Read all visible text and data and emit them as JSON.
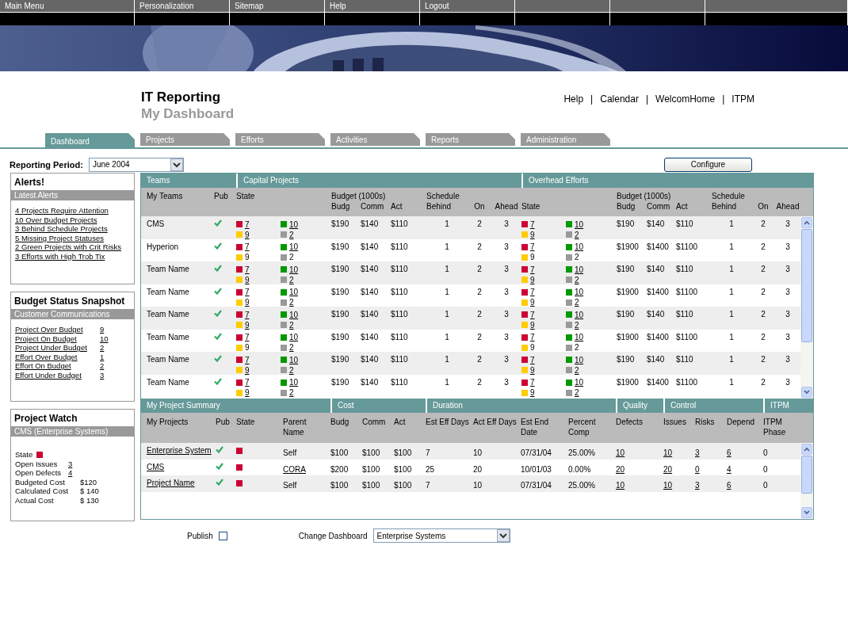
{
  "menu": [
    {
      "label": "Main Menu"
    },
    {
      "label": "Personalization"
    },
    {
      "label": "Sitemap"
    },
    {
      "label": "Help"
    },
    {
      "label": "Logout"
    }
  ],
  "header": {
    "title": "IT Reporting",
    "subtitle": "My Dashboard",
    "separator": "|",
    "links": [
      "Help",
      "Calendar",
      "WelcomHome",
      "ITPM"
    ]
  },
  "tabs": [
    {
      "label": "Dashboard",
      "selected": true
    },
    {
      "label": "Projects",
      "selected": false
    },
    {
      "label": "Efforts",
      "selected": false
    },
    {
      "label": "Activities",
      "selected": false
    },
    {
      "label": "Reports",
      "selected": false
    },
    {
      "label": "Administration",
      "selected": false
    }
  ],
  "reporting_period": {
    "label": "Reporting Period:",
    "value": "June 2004"
  },
  "configure_button": "Configure",
  "sidebar": [
    {
      "title": "Alerts!",
      "subtitle": "Latest Alerts",
      "items": [
        {
          "kind": "link",
          "label": "4 Projects Require Attention"
        },
        {
          "kind": "link",
          "label": "10 Over Budget Projects"
        },
        {
          "kind": "link",
          "label": "3 Behind Schedule Projects"
        },
        {
          "kind": "link",
          "label": "5 Missing Project Statuses"
        },
        {
          "kind": "link",
          "label": "2 Green Projects with Crit Risks"
        },
        {
          "kind": "link",
          "label": "3 Efforts with High Trob Tix"
        }
      ]
    },
    {
      "title": "Budget Status Snapshot",
      "subtitle": "Customer Communications",
      "items": [
        {
          "kind": "count",
          "label": "Project Over Budget",
          "value": "9"
        },
        {
          "kind": "count",
          "label": "Project On Budget",
          "value": "10"
        },
        {
          "kind": "count",
          "label": "Project Under Budget",
          "value": "2"
        },
        {
          "kind": "count",
          "label": "Effort Over Budget",
          "value": "1"
        },
        {
          "kind": "count",
          "label": "Effort On Budget",
          "value": "2"
        },
        {
          "kind": "count",
          "label": "Effort Under Budget",
          "value": "3"
        }
      ]
    },
    {
      "title": "Project Watch",
      "subtitle": "CMS (Enterprise Systems)",
      "items": [
        {
          "kind": "status",
          "label": "State",
          "color": "#cc0033"
        },
        {
          "kind": "count",
          "label": "Open Issues",
          "value": "3"
        },
        {
          "kind": "count",
          "label": "Open Defects",
          "value": "4"
        },
        {
          "kind": "text",
          "label": "Budgeted Cost",
          "value": "$120"
        },
        {
          "kind": "text",
          "label": "Calculated Cost",
          "value": "$ 140"
        },
        {
          "kind": "text",
          "label": "Actual Cost",
          "value": "$ 130"
        }
      ]
    }
  ],
  "teams_table": {
    "groups": [
      "Teams",
      "Capital Projects",
      "Overhead Efforts"
    ],
    "team_columns": {
      "name": "My Teams",
      "pub": "Pub"
    },
    "capital_columns": {
      "state": "State",
      "budget": "Budget (1000s)",
      "budg": "Budg",
      "comm": "Comm",
      "act": "Act",
      "schedule": "Schedule",
      "behind": "Behind",
      "on": "On",
      "ahead": "Ahead"
    },
    "overhead_columns": {
      "state": "State",
      "budget": "Budget (1000s)",
      "budg": "Budg",
      "comm": "Comm",
      "act": "Act",
      "schedule": "Schedule",
      "behind": "Behind",
      "on": "On",
      "ahead": "Ahead"
    },
    "rows": [
      {
        "name": "CMS",
        "pub": true,
        "capital": {
          "states": [
            {
              "color": "#cc0033",
              "count": "7",
              "linked": true
            },
            {
              "color": "#ffcc00",
              "count": "9",
              "linked": true
            },
            {
              "color": "#009900",
              "count": "10",
              "linked": true
            },
            {
              "color": "#999999",
              "count": "2",
              "linked": true
            }
          ],
          "budg": "$190",
          "comm": "$140",
          "act": "$110",
          "behind": "1",
          "on": "2",
          "ahead": "3"
        },
        "overhead": {
          "states": [
            {
              "color": "#cc0033",
              "count": "7",
              "linked": true
            },
            {
              "color": "#ffcc00",
              "count": "9",
              "linked": true
            },
            {
              "color": "#009900",
              "count": "10",
              "linked": true
            },
            {
              "color": "#999999",
              "count": "2",
              "linked": true
            }
          ],
          "budg": "$190",
          "comm": "$140",
          "act": "$110",
          "behind": "1",
          "on": "2",
          "ahead": "3"
        }
      },
      {
        "name": "Hyperion",
        "pub": true,
        "capital": {
          "states": [
            {
              "color": "#cc0033",
              "count": "7",
              "linked": true
            },
            {
              "color": "#ffcc00",
              "count": "9",
              "linked": false
            },
            {
              "color": "#009900",
              "count": "10",
              "linked": true
            },
            {
              "color": "#999999",
              "count": "2",
              "linked": false
            }
          ],
          "budg": "$190",
          "comm": "$140",
          "act": "$110",
          "behind": "1",
          "on": "2",
          "ahead": "3"
        },
        "overhead": {
          "states": [
            {
              "color": "#cc0033",
              "count": "7",
              "linked": true
            },
            {
              "color": "#ffcc00",
              "count": "9",
              "linked": false
            },
            {
              "color": "#009900",
              "count": "10",
              "linked": true
            },
            {
              "color": "#999999",
              "count": "2",
              "linked": false
            }
          ],
          "budg": "$1900",
          "comm": "$1400",
          "act": "$1100",
          "behind": "1",
          "on": "2",
          "ahead": "3"
        }
      },
      {
        "name": "Team Name",
        "pub": true,
        "capital": {
          "states": [
            {
              "color": "#cc0033",
              "count": "7",
              "linked": true
            },
            {
              "color": "#ffcc00",
              "count": "9",
              "linked": true
            },
            {
              "color": "#009900",
              "count": "10",
              "linked": true
            },
            {
              "color": "#999999",
              "count": "2",
              "linked": true
            }
          ],
          "budg": "$190",
          "comm": "$140",
          "act": "$110",
          "behind": "1",
          "on": "2",
          "ahead": "3"
        },
        "overhead": {
          "states": [
            {
              "color": "#cc0033",
              "count": "7",
              "linked": true
            },
            {
              "color": "#ffcc00",
              "count": "9",
              "linked": true
            },
            {
              "color": "#009900",
              "count": "10",
              "linked": true
            },
            {
              "color": "#999999",
              "count": "2",
              "linked": true
            }
          ],
          "budg": "$190",
          "comm": "$140",
          "act": "$110",
          "behind": "1",
          "on": "2",
          "ahead": "3"
        }
      },
      {
        "name": "Team Name",
        "pub": true,
        "capital": {
          "states": [
            {
              "color": "#cc0033",
              "count": "7",
              "linked": true
            },
            {
              "color": "#ffcc00",
              "count": "9",
              "linked": true
            },
            {
              "color": "#009900",
              "count": "10",
              "linked": true
            },
            {
              "color": "#999999",
              "count": "2",
              "linked": true
            }
          ],
          "budg": "$190",
          "comm": "$140",
          "act": "$110",
          "behind": "1",
          "on": "2",
          "ahead": "3"
        },
        "overhead": {
          "states": [
            {
              "color": "#cc0033",
              "count": "7",
              "linked": true
            },
            {
              "color": "#ffcc00",
              "count": "9",
              "linked": true
            },
            {
              "color": "#009900",
              "count": "10",
              "linked": true
            },
            {
              "color": "#999999",
              "count": "2",
              "linked": true
            }
          ],
          "budg": "$1900",
          "comm": "$1400",
          "act": "$1100",
          "behind": "1",
          "on": "2",
          "ahead": "3"
        }
      },
      {
        "name": "Team Name",
        "pub": true,
        "capital": {
          "states": [
            {
              "color": "#cc0033",
              "count": "7",
              "linked": true
            },
            {
              "color": "#ffcc00",
              "count": "9",
              "linked": true
            },
            {
              "color": "#009900",
              "count": "10",
              "linked": true
            },
            {
              "color": "#999999",
              "count": "2",
              "linked": true
            }
          ],
          "budg": "$190",
          "comm": "$140",
          "act": "$110",
          "behind": "1",
          "on": "2",
          "ahead": "3"
        },
        "overhead": {
          "states": [
            {
              "color": "#cc0033",
              "count": "7",
              "linked": true
            },
            {
              "color": "#ffcc00",
              "count": "9",
              "linked": true
            },
            {
              "color": "#009900",
              "count": "10",
              "linked": true
            },
            {
              "color": "#999999",
              "count": "2",
              "linked": true
            }
          ],
          "budg": "$190",
          "comm": "$140",
          "act": "$110",
          "behind": "1",
          "on": "2",
          "ahead": "3"
        }
      },
      {
        "name": "Team Name",
        "pub": true,
        "capital": {
          "states": [
            {
              "color": "#cc0033",
              "count": "7",
              "linked": true
            },
            {
              "color": "#ffcc00",
              "count": "9",
              "linked": false
            },
            {
              "color": "#009900",
              "count": "10",
              "linked": true
            },
            {
              "color": "#999999",
              "count": "2",
              "linked": true
            }
          ],
          "budg": "$190",
          "comm": "$140",
          "act": "$110",
          "behind": "1",
          "on": "2",
          "ahead": "3"
        },
        "overhead": {
          "states": [
            {
              "color": "#cc0033",
              "count": "7",
              "linked": true
            },
            {
              "color": "#ffcc00",
              "count": "9",
              "linked": false
            },
            {
              "color": "#009900",
              "count": "10",
              "linked": true
            },
            {
              "color": "#999999",
              "count": "2",
              "linked": false
            }
          ],
          "budg": "$1900",
          "comm": "$1400",
          "act": "$1100",
          "behind": "1",
          "on": "2",
          "ahead": "3"
        }
      },
      {
        "name": "Team Name",
        "pub": true,
        "capital": {
          "states": [
            {
              "color": "#cc0033",
              "count": "7",
              "linked": true
            },
            {
              "color": "#ffcc00",
              "count": "9",
              "linked": true
            },
            {
              "color": "#009900",
              "count": "10",
              "linked": true
            },
            {
              "color": "#999999",
              "count": "2",
              "linked": true
            }
          ],
          "budg": "$190",
          "comm": "$140",
          "act": "$110",
          "behind": "1",
          "on": "2",
          "ahead": "3"
        },
        "overhead": {
          "states": [
            {
              "color": "#cc0033",
              "count": "7",
              "linked": true
            },
            {
              "color": "#ffcc00",
              "count": "9",
              "linked": true
            },
            {
              "color": "#009900",
              "count": "10",
              "linked": true
            },
            {
              "color": "#999999",
              "count": "2",
              "linked": true
            }
          ],
          "budg": "$190",
          "comm": "$140",
          "act": "$110",
          "behind": "1",
          "on": "2",
          "ahead": "3"
        }
      },
      {
        "name": "Team Name",
        "pub": true,
        "capital": {
          "states": [
            {
              "color": "#cc0033",
              "count": "7",
              "linked": true
            },
            {
              "color": "#ffcc00",
              "count": "9",
              "linked": true
            },
            {
              "color": "#009900",
              "count": "10",
              "linked": true
            },
            {
              "color": "#999999",
              "count": "2",
              "linked": true
            }
          ],
          "budg": "$190",
          "comm": "$140",
          "act": "$110",
          "behind": "1",
          "on": "2",
          "ahead": "3"
        },
        "overhead": {
          "states": [
            {
              "color": "#cc0033",
              "count": "7",
              "linked": true
            },
            {
              "color": "#ffcc00",
              "count": "9",
              "linked": true
            },
            {
              "color": "#009900",
              "count": "10",
              "linked": true
            },
            {
              "color": "#999999",
              "count": "2",
              "linked": true
            }
          ],
          "budg": "$1900",
          "comm": "$1400",
          "act": "$1100",
          "behind": "1",
          "on": "2",
          "ahead": "3"
        }
      }
    ]
  },
  "summary_table": {
    "groups": [
      "My Project Summary",
      "Cost",
      "Duration",
      "Quality",
      "Control",
      "ITPM"
    ],
    "columns": [
      "My Projects",
      "Pub",
      "State",
      "Parent Name",
      "Budg",
      "Comm",
      "Act",
      "Est Eff Days",
      "Act Eff Days",
      "Est End Date",
      "Percent Comp",
      "Defects",
      "Issues",
      "Risks",
      "Depend",
      "ITPM Phase"
    ],
    "rows": [
      {
        "name": "Enterprise System",
        "pub": true,
        "color": "#cc0033",
        "parent": "Self",
        "parent_linked": false,
        "budg": "$100",
        "comm": "$100",
        "act": "$100",
        "est_eff_days": "7",
        "act_eff_days": "10",
        "est_end_date": "07/31/04",
        "percent_comp": "25.00%",
        "defects": "10",
        "issues": "10",
        "risks": "3",
        "depend": "6",
        "itpm_phase": "0"
      },
      {
        "name": "CMS",
        "pub": true,
        "color": "#cc0033",
        "parent": "CORA",
        "parent_linked": true,
        "budg": "$200",
        "comm": "$100",
        "act": "$100",
        "est_eff_days": "25",
        "act_eff_days": "20",
        "est_end_date": "10/01/03",
        "percent_comp": "0.00%",
        "defects": "20",
        "issues": "20",
        "risks": "0",
        "depend": "4",
        "itpm_phase": "0"
      },
      {
        "name": "Project Name",
        "pub": true,
        "color": "#cc0033",
        "parent": "Self",
        "parent_linked": false,
        "budg": "$100",
        "comm": "$100",
        "act": "$100",
        "est_eff_days": "7",
        "act_eff_days": "10",
        "est_end_date": "07/31/04",
        "percent_comp": "25.00%",
        "defects": "10",
        "issues": "10",
        "risks": "3",
        "depend": "6",
        "itpm_phase": "0"
      }
    ]
  },
  "footer": {
    "publish": {
      "label": "Publish",
      "checked": false
    },
    "change_dashboard": {
      "label": "Change Dashboard",
      "value": "Enterprise Systems"
    }
  }
}
